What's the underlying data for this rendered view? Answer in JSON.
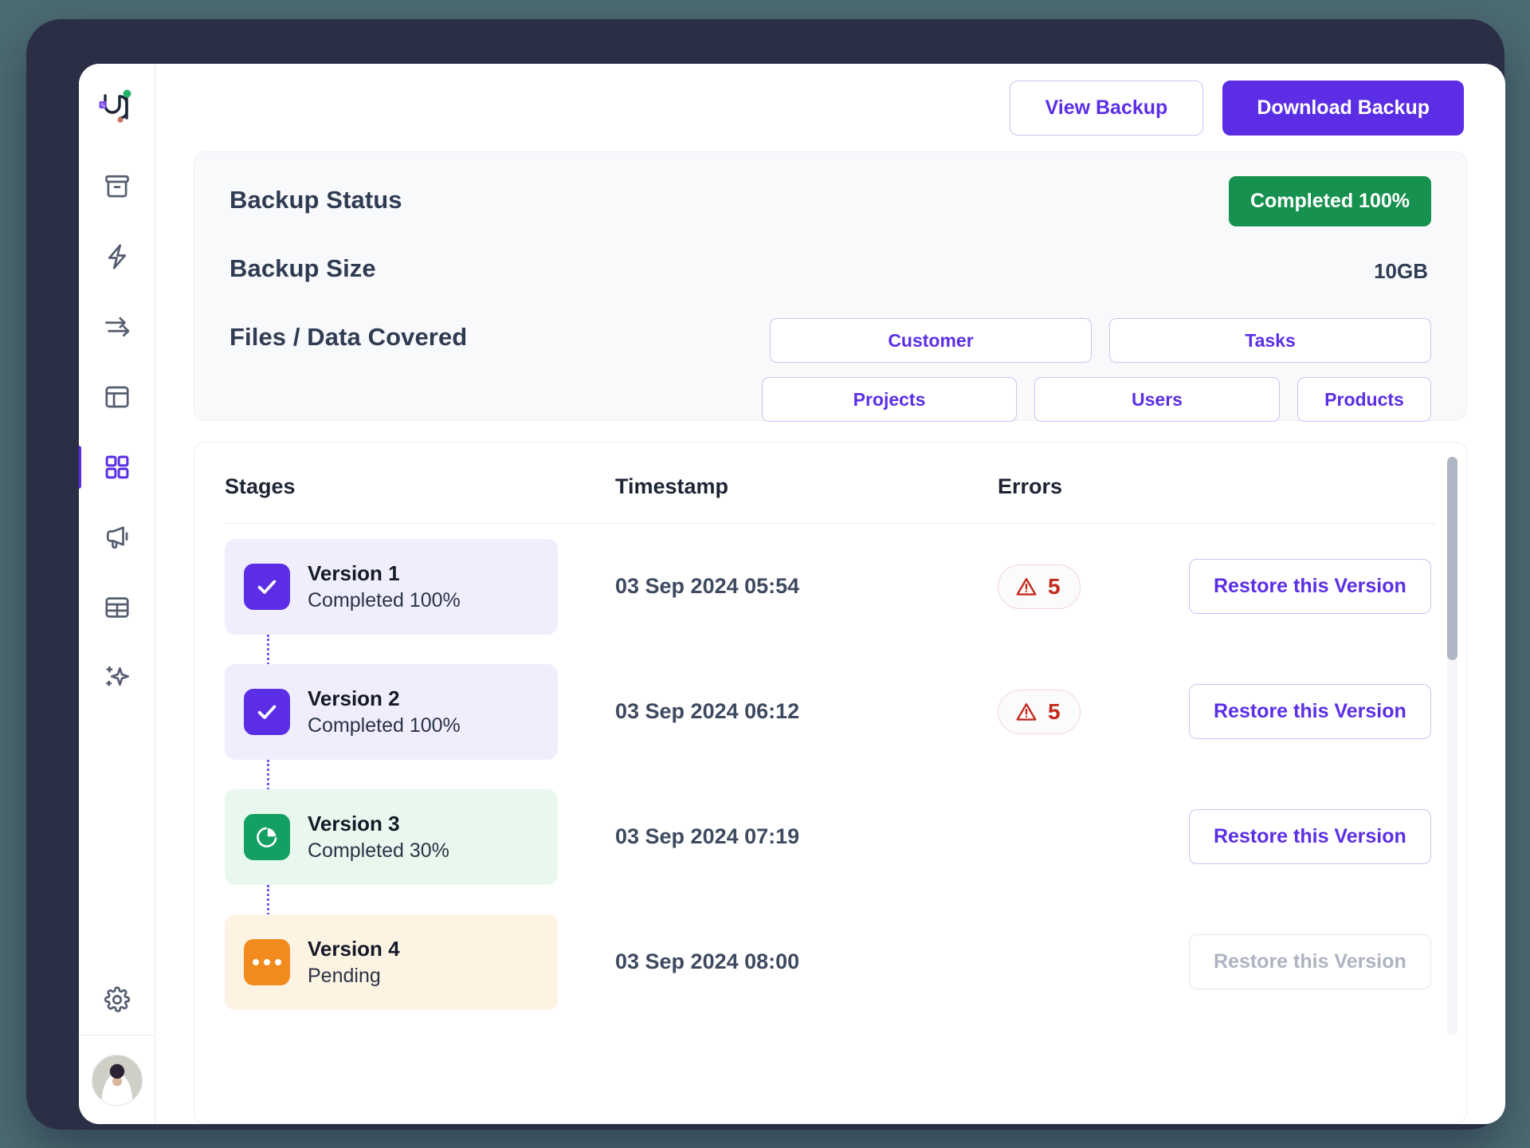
{
  "app": {
    "logo_name": "brand-logo"
  },
  "sidebar": {
    "items": [
      {
        "name": "archive-icon",
        "label": "Archive",
        "active": false
      },
      {
        "name": "bolt-icon",
        "label": "Automation",
        "active": false
      },
      {
        "name": "transfer-icon",
        "label": "Transfer",
        "active": false
      },
      {
        "name": "layout-icon",
        "label": "Layout",
        "active": false
      },
      {
        "name": "grid-icon",
        "label": "Dashboard",
        "active": true
      },
      {
        "name": "megaphone-icon",
        "label": "Announcements",
        "active": false
      },
      {
        "name": "table-icon",
        "label": "Tables",
        "active": false
      },
      {
        "name": "sparkles-icon",
        "label": "AI Assist",
        "active": false
      }
    ],
    "settings": {
      "name": "gear-icon",
      "label": "Settings"
    },
    "avatar": {
      "name": "user-avatar",
      "label": "Profile"
    }
  },
  "topbar": {
    "view_backup_label": "View Backup",
    "download_backup_label": "Download Backup"
  },
  "summary": {
    "status_label": "Backup Status",
    "status_value": "Completed 100%",
    "size_label": "Backup Size",
    "size_value": "10GB",
    "coverage_label": "Files / Data Covered",
    "tags": [
      "Customer",
      "Tasks",
      "Projects",
      "Users",
      "Products"
    ]
  },
  "table": {
    "headers": {
      "stages": "Stages",
      "timestamp": "Timestamp",
      "errors": "Errors"
    },
    "rows": [
      {
        "version": "Version 1",
        "status": "Completed 100%",
        "timestamp": "03 Sep 2024 05:54",
        "errors": "5",
        "action": "Restore this Version",
        "action_enabled": true
      },
      {
        "version": "Version 2",
        "status": "Completed 100%",
        "timestamp": "03 Sep 2024 06:12",
        "errors": "5",
        "action": "Restore this Version",
        "action_enabled": true
      },
      {
        "version": "Version 3",
        "status": "Completed 30%",
        "timestamp": "03 Sep 2024 07:19",
        "errors": "",
        "action": "Restore  this Version",
        "action_enabled": true
      },
      {
        "version": "Version 4",
        "status": "Pending",
        "timestamp": "03 Sep 2024 08:00",
        "errors": "",
        "action": "Restore this Version",
        "action_enabled": false
      }
    ]
  },
  "colors": {
    "accent": "#5b2ee5",
    "success": "#17914f",
    "warning": "#f28b1d",
    "green_icon": "#13a062",
    "error": "#c32a1d",
    "frame": "#2b2f46",
    "page_bg": "#4c6b72"
  }
}
